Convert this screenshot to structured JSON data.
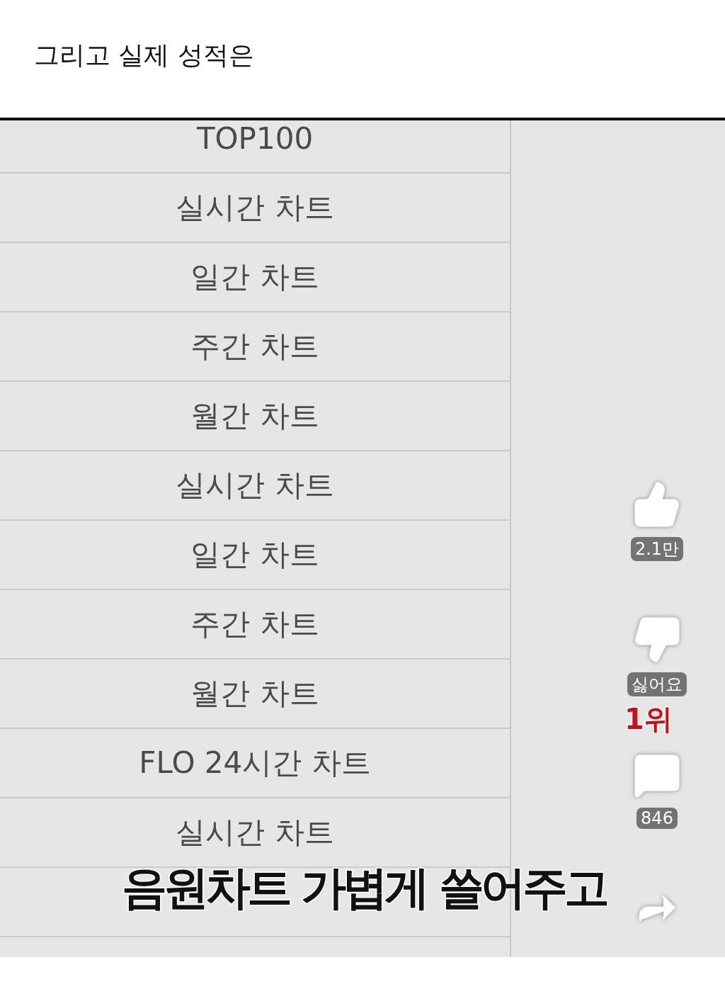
{
  "post": {
    "title": "그리고 실제 성적은"
  },
  "video": {
    "chart_rows": [
      "TOP100",
      "실시간 차트",
      "일간 차트",
      "주간 차트",
      "월간 차트",
      "실시간 차트",
      "일간 차트",
      "주간 차트",
      "월간 차트",
      "FLO 24시간 차트",
      "실시간 차트"
    ],
    "actions": [
      {
        "kind": "like",
        "label": "2.1만"
      },
      {
        "kind": "dislike",
        "label": "싫어요"
      },
      {
        "kind": "comment",
        "label": "846"
      },
      {
        "kind": "share"
      }
    ],
    "rank_caption": "1위",
    "subtitle": "음원차트 가볍게 쓸어주고"
  }
}
